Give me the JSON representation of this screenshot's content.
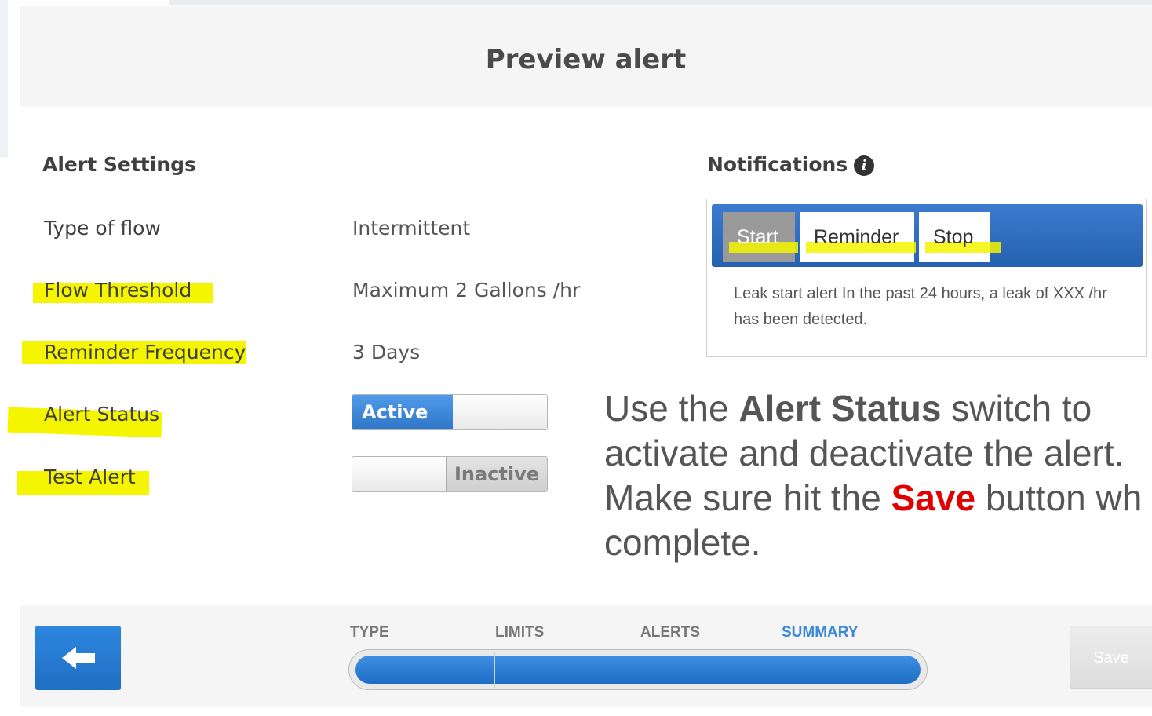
{
  "header": {
    "title": "Preview alert"
  },
  "alert_settings": {
    "title": "Alert Settings",
    "rows": [
      {
        "label": "Type of flow",
        "value": "Intermittent"
      },
      {
        "label": "Flow Threshold",
        "value": "Maximum 2 Gallons /hr"
      },
      {
        "label": "Reminder Frequency",
        "value": "3 Days"
      },
      {
        "label": "Alert Status",
        "toggle_label": "Active",
        "toggle_state": "on"
      },
      {
        "label": "Test Alert",
        "toggle_label": "Inactive",
        "toggle_state": "off"
      }
    ]
  },
  "notifications": {
    "title": "Notifications",
    "info_icon": "info-icon",
    "tabs": [
      {
        "label": "Start",
        "selected": true
      },
      {
        "label": "Reminder",
        "selected": false
      },
      {
        "label": "Stop",
        "selected": false
      }
    ],
    "message": "Leak start alert In the past 24 hours, a leak of XXX /hr has been detected."
  },
  "instruction": {
    "part1": "Use the ",
    "bold1": "Alert Status",
    "part2": " switch to",
    "line2": "activate and deactivate the alert.",
    "part3": "Make sure hit the ",
    "save_word": "Save",
    "part4": " button wh",
    "line4": "complete."
  },
  "footer": {
    "back_icon": "arrow-left-icon",
    "steps": [
      "TYPE",
      "LIMITS",
      "ALERTS",
      "SUMMARY"
    ],
    "active_step": "SUMMARY",
    "progress_percent": 100,
    "save_label": "Save"
  },
  "colors": {
    "highlight": "#f5f500",
    "accent_blue": "#2f77c8",
    "save_red": "#e10000"
  }
}
